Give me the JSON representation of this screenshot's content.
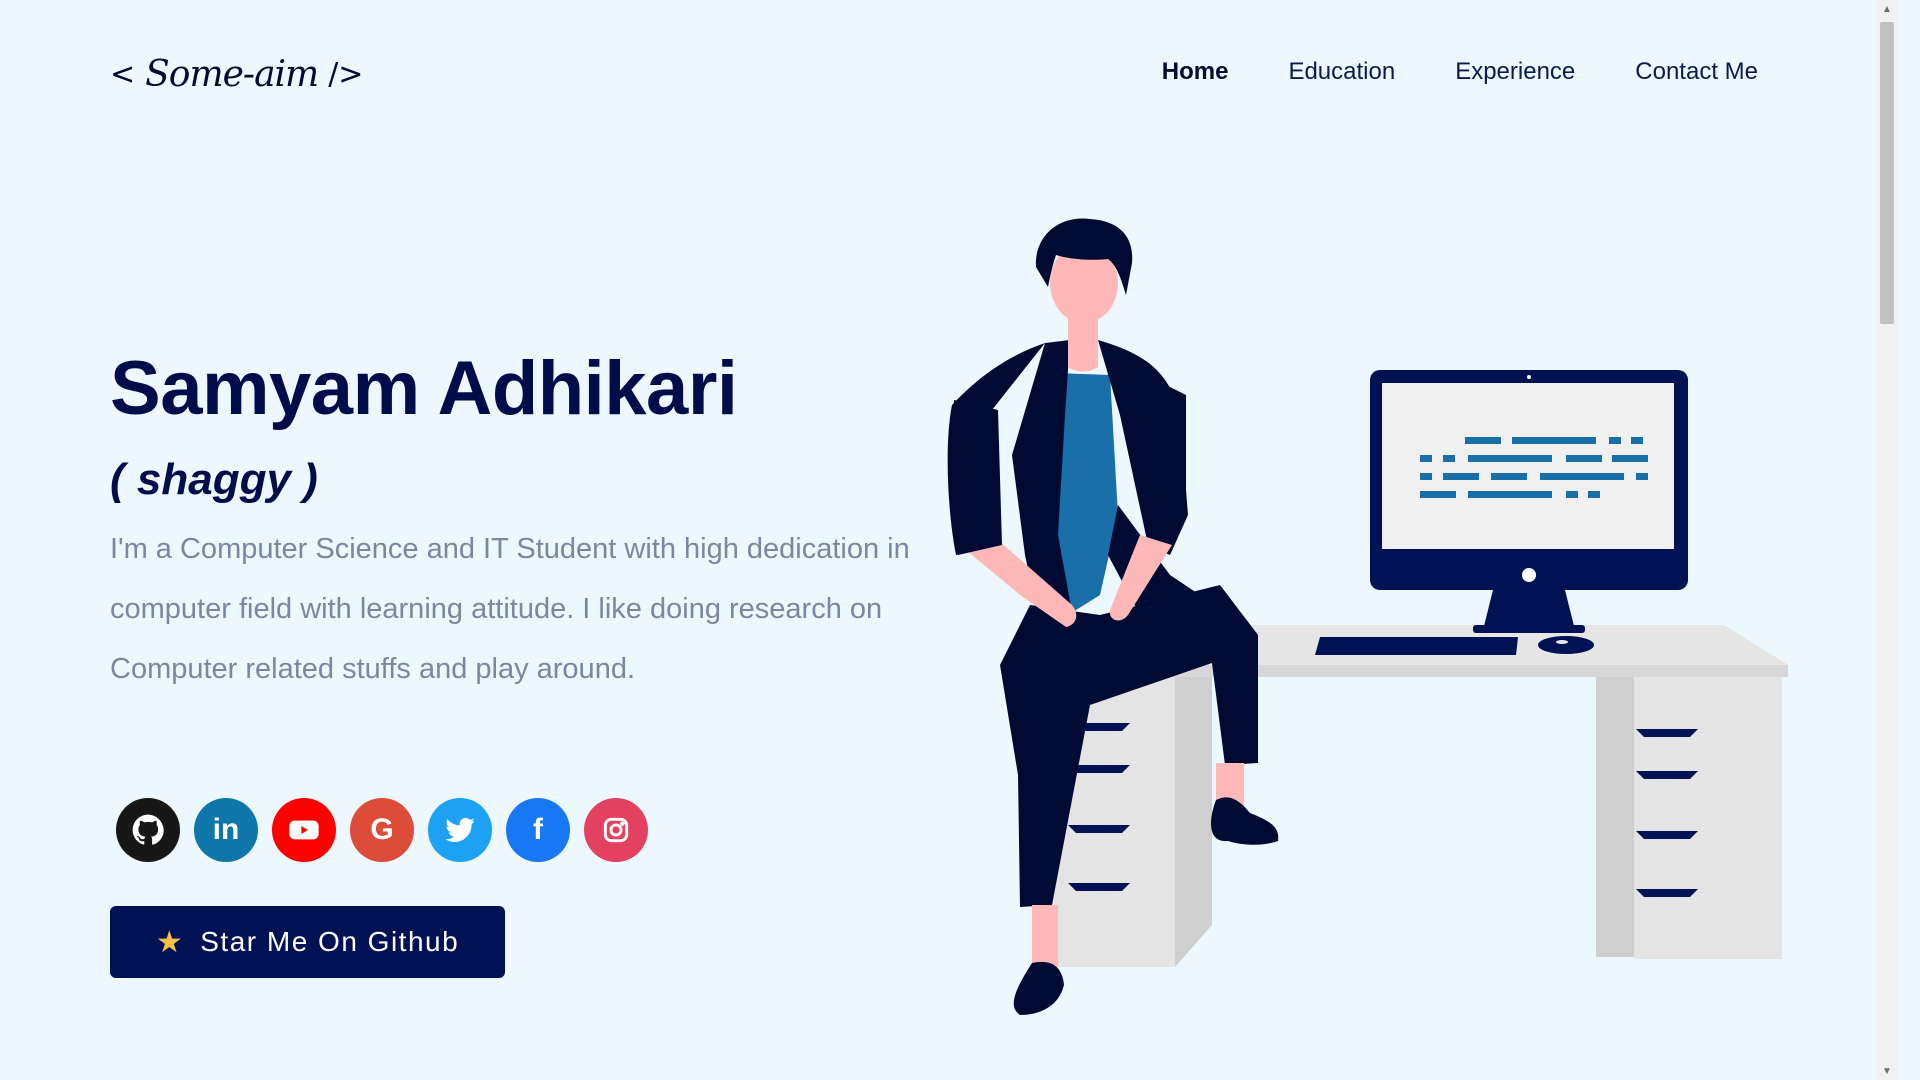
{
  "header": {
    "logo_open": "<",
    "logo_signature": "Some-aim",
    "logo_close": "/>",
    "nav": [
      {
        "label": "Home",
        "active": true
      },
      {
        "label": "Education",
        "active": false
      },
      {
        "label": "Experience",
        "active": false
      },
      {
        "label": "Contact Me",
        "active": false
      }
    ]
  },
  "hero": {
    "name": "Samyam Adhikari",
    "nickname": "( shaggy )",
    "bio": "I'm a Computer Science and IT Student with high dedication in computer field with learning attitude. I like doing research on Computer related stuffs and play around."
  },
  "socials": [
    {
      "name": "github",
      "icon": "github-icon",
      "color": "#181717"
    },
    {
      "name": "linkedin",
      "icon": "linkedin-icon",
      "color": "#0e76a8",
      "glyph": "in"
    },
    {
      "name": "youtube",
      "icon": "youtube-icon",
      "color": "#ff0000"
    },
    {
      "name": "google",
      "icon": "google-icon",
      "color": "#dd4b39",
      "glyph": "G"
    },
    {
      "name": "twitter",
      "icon": "twitter-icon",
      "color": "#1da1f2"
    },
    {
      "name": "facebook",
      "icon": "facebook-icon",
      "color": "#1877f2",
      "glyph": "f"
    },
    {
      "name": "instagram",
      "icon": "instagram-icon",
      "color": "#e4405f"
    }
  ],
  "cta": {
    "star_icon": "star-icon",
    "label": "Star Me On Github"
  },
  "colors": {
    "background": "#ecf7fe",
    "primary": "#000d4a",
    "text_muted": "#7a87a1",
    "accent_blue": "#1970a8"
  }
}
